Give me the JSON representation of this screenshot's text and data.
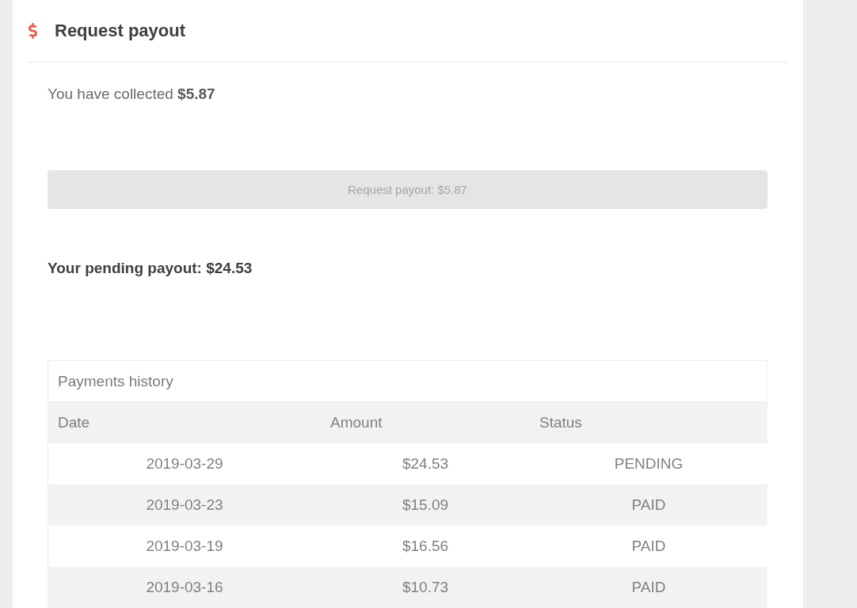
{
  "header": {
    "title": "Request payout"
  },
  "balance": {
    "text": "You have collected **$5.87**"
  },
  "request_button": {
    "label": "Request payout: $5.87",
    "disabled": true
  },
  "pending": {
    "text": "Your pending payout: $24.53"
  },
  "payments_history": {
    "title": "Payments history",
    "columns": [
      "Date",
      "Amount",
      "Status"
    ],
    "rows": [
      {
        "date": "2019-03-29",
        "amount": "$24.53",
        "status": "PENDING"
      },
      {
        "date": "2019-03-23",
        "amount": "$15.09",
        "status": "PAID"
      },
      {
        "date": "2019-03-19",
        "amount": "$16.56",
        "status": "PAID"
      },
      {
        "date": "2019-03-16",
        "amount": "$10.73",
        "status": "PAID"
      }
    ]
  }
}
